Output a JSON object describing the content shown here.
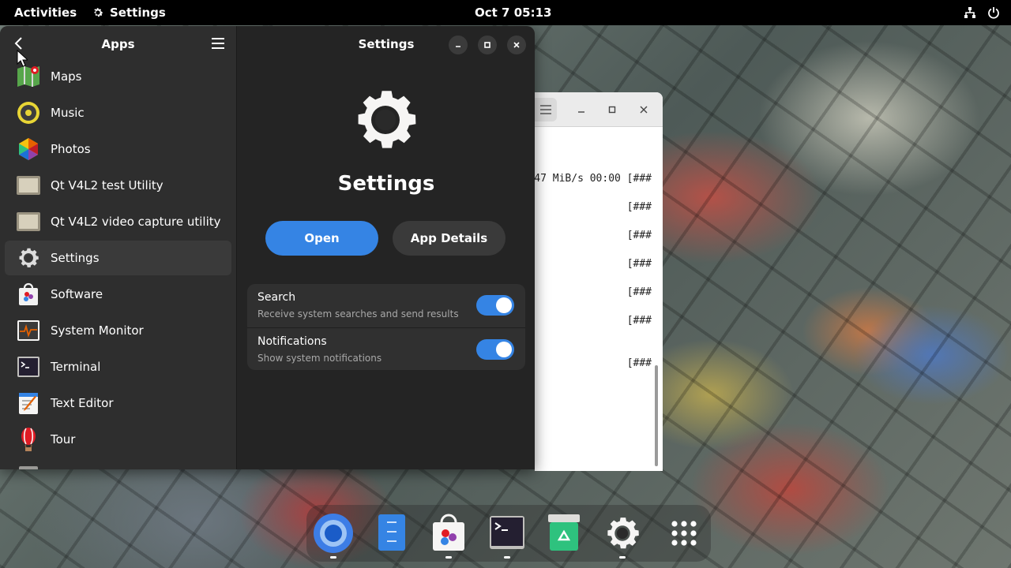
{
  "topbar": {
    "activities": "Activities",
    "app_name": "Settings",
    "clock": "Oct 7  05:13",
    "icons": [
      "network-icon",
      "power-icon"
    ]
  },
  "apps_panel": {
    "title": "Apps",
    "items": [
      {
        "label": "Maps",
        "icon": "maps-icon"
      },
      {
        "label": "Music",
        "icon": "music-icon"
      },
      {
        "label": "Photos",
        "icon": "photos-icon"
      },
      {
        "label": "Qt V4L2 test Utility",
        "icon": "qt-v4l2-test-icon"
      },
      {
        "label": "Qt V4L2 video capture utility",
        "icon": "qt-v4l2-capture-icon"
      },
      {
        "label": "Settings",
        "icon": "settings-icon",
        "selected": true
      },
      {
        "label": "Software",
        "icon": "software-icon"
      },
      {
        "label": "System Monitor",
        "icon": "system-monitor-icon"
      },
      {
        "label": "Terminal",
        "icon": "terminal-icon"
      },
      {
        "label": "Text Editor",
        "icon": "text-editor-icon"
      },
      {
        "label": "Tour",
        "icon": "tour-icon"
      }
    ]
  },
  "app_detail": {
    "window_title": "Settings",
    "app_title": "Settings",
    "open_label": "Open",
    "details_label": "App Details",
    "prefs": [
      {
        "title": "Search",
        "subtitle": "Receive system searches and send results",
        "enabled": true
      },
      {
        "title": "Notifications",
        "subtitle": "Show system notifications",
        "enabled": true
      }
    ]
  },
  "terminal": {
    "lines": [
      "47 MiB/s 00:00 [###",
      "[###",
      "[###",
      "[###",
      "[###",
      "[###",
      "[###"
    ]
  },
  "dock": {
    "items": [
      "chrome-icon",
      "files-icon",
      "software-icon",
      "terminal-icon",
      "trash-icon",
      "settings-icon",
      "show-apps-icon"
    ]
  },
  "colors": {
    "accent": "#3584e4",
    "window_bg": "#242424",
    "sidebar_bg": "#2e2e2e",
    "topbar_bg": "#000000"
  }
}
